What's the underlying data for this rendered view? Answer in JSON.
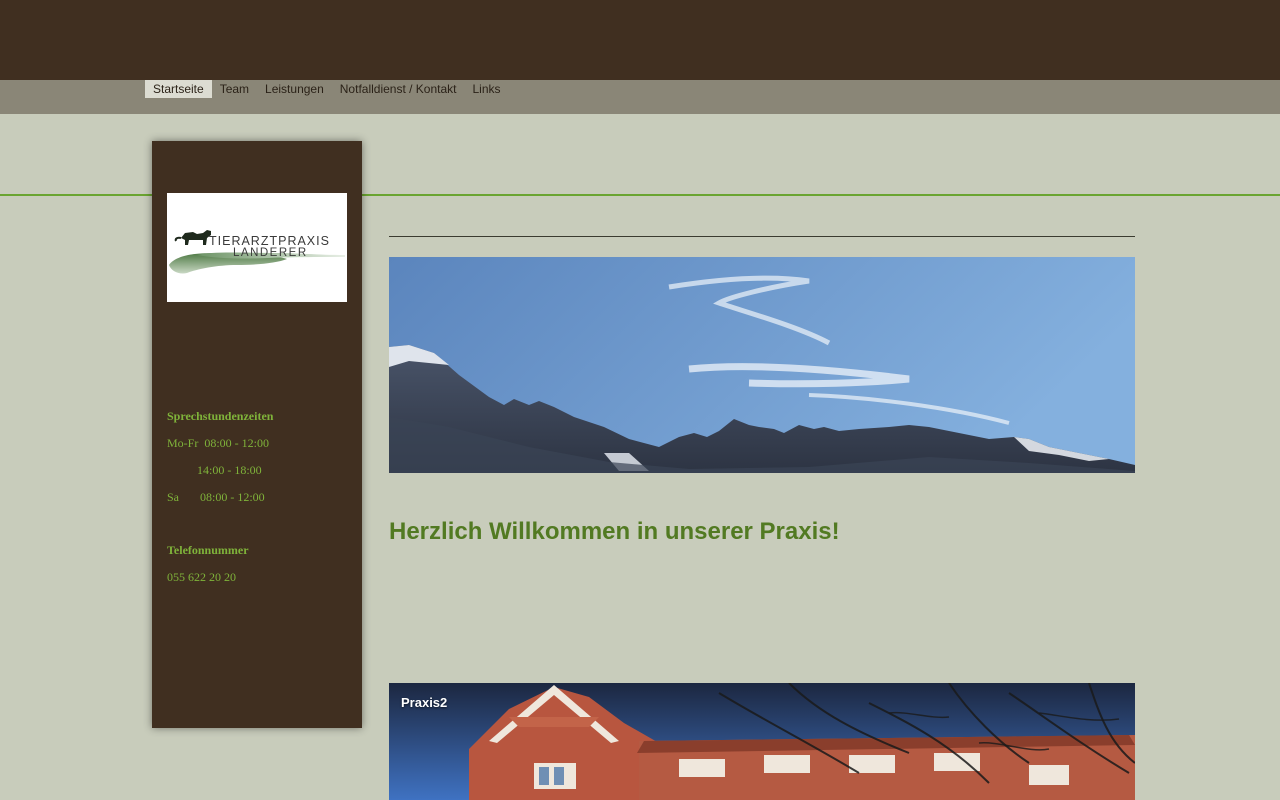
{
  "nav": {
    "items": [
      {
        "label": "Startseite",
        "active": true
      },
      {
        "label": "Team",
        "active": false
      },
      {
        "label": "Leistungen",
        "active": false
      },
      {
        "label": "Notfalldienst / Kontakt",
        "active": false
      },
      {
        "label": "Links",
        "active": false
      }
    ]
  },
  "sidebar": {
    "logo": {
      "line1": "TIERARZTPRAXIS",
      "line2": "LANDERER"
    },
    "hours": {
      "heading": "Sprechstundenzeiten",
      "row1": "Mo-Fr  08:00 - 12:00",
      "row2": "          14:00 - 18:00",
      "row3": "Sa       08:00 - 12:00"
    },
    "phone": {
      "heading": "Telefonnummer",
      "number": "055 622 20 20"
    }
  },
  "main": {
    "welcome": "Herzlich Willkommen in unserer Praxis!",
    "photo_caption": "Praxis2"
  },
  "colors": {
    "header_brown": "#402f20",
    "nav_bar": "#8a8677",
    "page_bg": "#c8ccbb",
    "accent_green": "#6aa431",
    "heading_green": "#527a22",
    "sidebar_text_green": "#7fb33a"
  }
}
